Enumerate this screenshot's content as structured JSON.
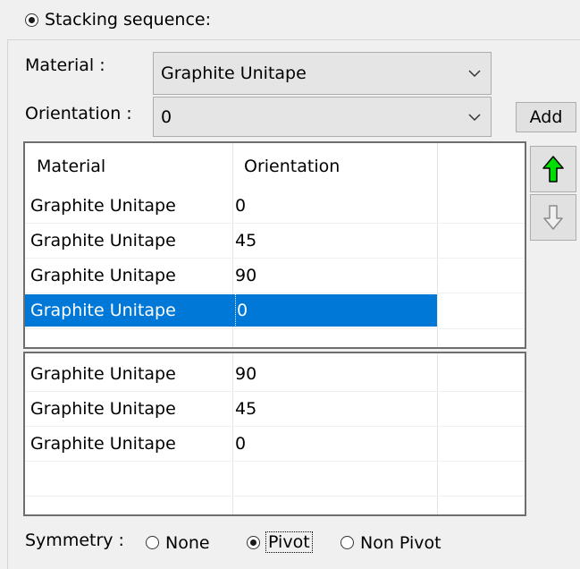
{
  "stacking": {
    "label": "Stacking sequence:",
    "checked": true
  },
  "material": {
    "label": "Material :",
    "value": "Graphite Unitape"
  },
  "orientation": {
    "label": "Orientation :",
    "value": "0"
  },
  "add_button": "Add",
  "icons": {
    "move_up": "arrow-up-icon",
    "move_down": "arrow-down-icon"
  },
  "colors": {
    "selection": "#0078d7",
    "up_arrow": "#00e000"
  },
  "table": {
    "headers": {
      "material": "Material",
      "orientation": "Orientation"
    },
    "rows": [
      {
        "material": "Graphite Unitape",
        "orientation": "0"
      },
      {
        "material": "Graphite Unitape",
        "orientation": "45"
      },
      {
        "material": "Graphite Unitape",
        "orientation": "90"
      },
      {
        "material": "Graphite Unitape",
        "orientation": "0",
        "selected": true
      }
    ]
  },
  "mirror_table": {
    "rows": [
      {
        "material": "Graphite Unitape",
        "orientation": "90"
      },
      {
        "material": "Graphite Unitape",
        "orientation": "45"
      },
      {
        "material": "Graphite Unitape",
        "orientation": "0"
      }
    ]
  },
  "symmetry": {
    "label": "Symmetry :",
    "options": [
      "None",
      "Pivot",
      "Non Pivot"
    ],
    "selected": "Pivot"
  }
}
